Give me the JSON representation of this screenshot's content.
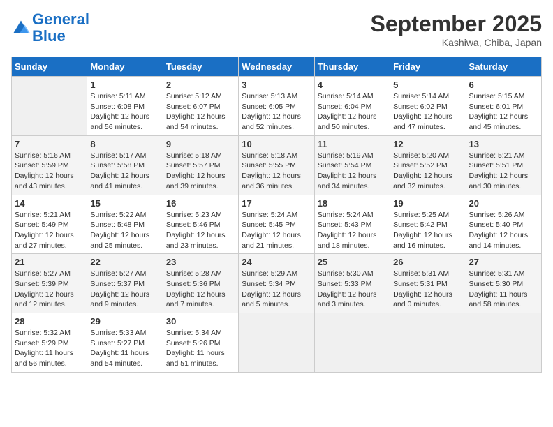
{
  "header": {
    "logo_line1": "General",
    "logo_line2": "Blue",
    "month": "September 2025",
    "location": "Kashiwa, Chiba, Japan"
  },
  "columns": [
    "Sunday",
    "Monday",
    "Tuesday",
    "Wednesday",
    "Thursday",
    "Friday",
    "Saturday"
  ],
  "weeks": [
    [
      {
        "day": "",
        "info": ""
      },
      {
        "day": "1",
        "info": "Sunrise: 5:11 AM\nSunset: 6:08 PM\nDaylight: 12 hours\nand 56 minutes."
      },
      {
        "day": "2",
        "info": "Sunrise: 5:12 AM\nSunset: 6:07 PM\nDaylight: 12 hours\nand 54 minutes."
      },
      {
        "day": "3",
        "info": "Sunrise: 5:13 AM\nSunset: 6:05 PM\nDaylight: 12 hours\nand 52 minutes."
      },
      {
        "day": "4",
        "info": "Sunrise: 5:14 AM\nSunset: 6:04 PM\nDaylight: 12 hours\nand 50 minutes."
      },
      {
        "day": "5",
        "info": "Sunrise: 5:14 AM\nSunset: 6:02 PM\nDaylight: 12 hours\nand 47 minutes."
      },
      {
        "day": "6",
        "info": "Sunrise: 5:15 AM\nSunset: 6:01 PM\nDaylight: 12 hours\nand 45 minutes."
      }
    ],
    [
      {
        "day": "7",
        "info": "Sunrise: 5:16 AM\nSunset: 5:59 PM\nDaylight: 12 hours\nand 43 minutes."
      },
      {
        "day": "8",
        "info": "Sunrise: 5:17 AM\nSunset: 5:58 PM\nDaylight: 12 hours\nand 41 minutes."
      },
      {
        "day": "9",
        "info": "Sunrise: 5:18 AM\nSunset: 5:57 PM\nDaylight: 12 hours\nand 39 minutes."
      },
      {
        "day": "10",
        "info": "Sunrise: 5:18 AM\nSunset: 5:55 PM\nDaylight: 12 hours\nand 36 minutes."
      },
      {
        "day": "11",
        "info": "Sunrise: 5:19 AM\nSunset: 5:54 PM\nDaylight: 12 hours\nand 34 minutes."
      },
      {
        "day": "12",
        "info": "Sunrise: 5:20 AM\nSunset: 5:52 PM\nDaylight: 12 hours\nand 32 minutes."
      },
      {
        "day": "13",
        "info": "Sunrise: 5:21 AM\nSunset: 5:51 PM\nDaylight: 12 hours\nand 30 minutes."
      }
    ],
    [
      {
        "day": "14",
        "info": "Sunrise: 5:21 AM\nSunset: 5:49 PM\nDaylight: 12 hours\nand 27 minutes."
      },
      {
        "day": "15",
        "info": "Sunrise: 5:22 AM\nSunset: 5:48 PM\nDaylight: 12 hours\nand 25 minutes."
      },
      {
        "day": "16",
        "info": "Sunrise: 5:23 AM\nSunset: 5:46 PM\nDaylight: 12 hours\nand 23 minutes."
      },
      {
        "day": "17",
        "info": "Sunrise: 5:24 AM\nSunset: 5:45 PM\nDaylight: 12 hours\nand 21 minutes."
      },
      {
        "day": "18",
        "info": "Sunrise: 5:24 AM\nSunset: 5:43 PM\nDaylight: 12 hours\nand 18 minutes."
      },
      {
        "day": "19",
        "info": "Sunrise: 5:25 AM\nSunset: 5:42 PM\nDaylight: 12 hours\nand 16 minutes."
      },
      {
        "day": "20",
        "info": "Sunrise: 5:26 AM\nSunset: 5:40 PM\nDaylight: 12 hours\nand 14 minutes."
      }
    ],
    [
      {
        "day": "21",
        "info": "Sunrise: 5:27 AM\nSunset: 5:39 PM\nDaylight: 12 hours\nand 12 minutes."
      },
      {
        "day": "22",
        "info": "Sunrise: 5:27 AM\nSunset: 5:37 PM\nDaylight: 12 hours\nand 9 minutes."
      },
      {
        "day": "23",
        "info": "Sunrise: 5:28 AM\nSunset: 5:36 PM\nDaylight: 12 hours\nand 7 minutes."
      },
      {
        "day": "24",
        "info": "Sunrise: 5:29 AM\nSunset: 5:34 PM\nDaylight: 12 hours\nand 5 minutes."
      },
      {
        "day": "25",
        "info": "Sunrise: 5:30 AM\nSunset: 5:33 PM\nDaylight: 12 hours\nand 3 minutes."
      },
      {
        "day": "26",
        "info": "Sunrise: 5:31 AM\nSunset: 5:31 PM\nDaylight: 12 hours\nand 0 minutes."
      },
      {
        "day": "27",
        "info": "Sunrise: 5:31 AM\nSunset: 5:30 PM\nDaylight: 11 hours\nand 58 minutes."
      }
    ],
    [
      {
        "day": "28",
        "info": "Sunrise: 5:32 AM\nSunset: 5:29 PM\nDaylight: 11 hours\nand 56 minutes."
      },
      {
        "day": "29",
        "info": "Sunrise: 5:33 AM\nSunset: 5:27 PM\nDaylight: 11 hours\nand 54 minutes."
      },
      {
        "day": "30",
        "info": "Sunrise: 5:34 AM\nSunset: 5:26 PM\nDaylight: 11 hours\nand 51 minutes."
      },
      {
        "day": "",
        "info": ""
      },
      {
        "day": "",
        "info": ""
      },
      {
        "day": "",
        "info": ""
      },
      {
        "day": "",
        "info": ""
      }
    ]
  ]
}
